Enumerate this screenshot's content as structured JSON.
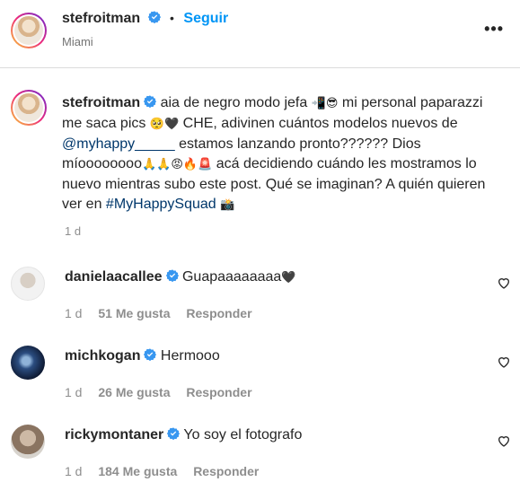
{
  "header": {
    "username": "stefroitman",
    "separator": "•",
    "follow_label": "Seguir",
    "location": "Miami",
    "more_label": "•••"
  },
  "caption": {
    "username": "stefroitman",
    "part1": " aia de negro modo jefa ",
    "emoji1": "📲😎",
    "part2": " mi personal paparazzi me saca pics ",
    "emoji2": "🥺🖤",
    "part3": " CHE, adivinen cuántos modelos nuevos de ",
    "mention": "@myhappy_____",
    "part4": " estamos lanzando pronto?????? Dios míoooooooo",
    "emoji3": "🙏🙏😡🔥🚨",
    "part5": " acá decidiendo cuándo les mostramos lo nuevo mientras subo este post. Qué se imaginan? A quién quieren ver en ",
    "hashtag": "#MyHappySquad",
    "emoji4": "📸",
    "time": "1 d"
  },
  "comments": [
    {
      "username": "danielaacallee",
      "text": "Guapaaaaaaaa",
      "emoji": "🖤",
      "time": "1 d",
      "likes": "51 Me gusta",
      "reply_label": "Responder",
      "avatar_color": "#e6e6e6"
    },
    {
      "username": "michkogan",
      "text": "Hermooo",
      "emoji": "",
      "time": "1 d",
      "likes": "26 Me gusta",
      "reply_label": "Responder",
      "avatar_color": "#1d3a6b"
    },
    {
      "username": "rickymontaner",
      "text": "Yo soy el fotografo",
      "emoji": "",
      "time": "1 d",
      "likes": "184 Me gusta",
      "reply_label": "Responder",
      "avatar_color": "#b9a48f"
    }
  ],
  "colors": {
    "accent": "#0095f6",
    "link": "#00376b",
    "muted": "#8e8e8e",
    "verified": "#3897f0"
  }
}
